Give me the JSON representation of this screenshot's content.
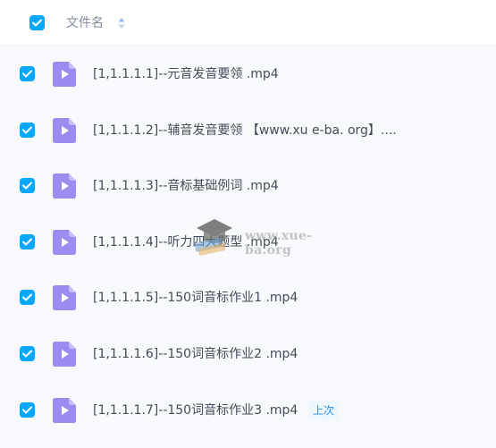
{
  "header": {
    "column_label": "文件名"
  },
  "files": [
    {
      "name": "[1,1.1.1.1]--元音发音要领 .mp4"
    },
    {
      "name": "[1,1.1.1.2]--辅音发音要领 【www.xu e-ba. org】...."
    },
    {
      "name": "[1,1.1.1.3]--音标基础例词 .mp4"
    },
    {
      "name": "[1,1.1.1.4]--听力四大题型 .mp4"
    },
    {
      "name": "[1,1.1.1.5]--150词音标作业1 .mp4"
    },
    {
      "name": "[1,1.1.1.6]--150词音标作业2 .mp4"
    },
    {
      "name": "[1,1.1.1.7]--150词音标作业3 .mp4",
      "badge": "上次"
    }
  ],
  "watermark": {
    "text": "www.xue-ba.org"
  },
  "colors": {
    "accent": "#06a7ff",
    "file_icon": "#9b8cf0",
    "badge_text": "#2b8fe8"
  }
}
